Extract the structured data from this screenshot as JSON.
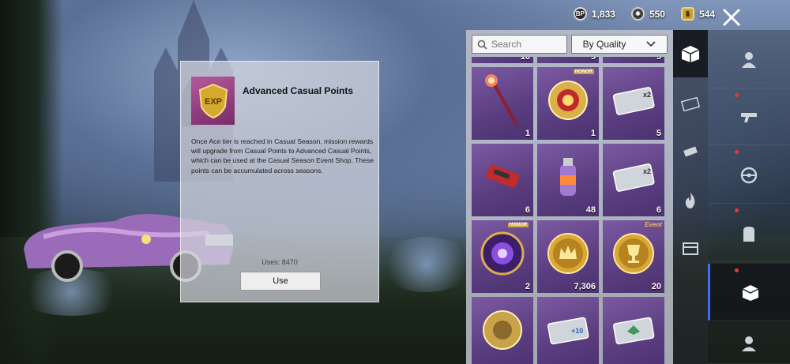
{
  "currencies": [
    {
      "icon": "bp-coin-icon",
      "glyph": "BP",
      "value": "1,833"
    },
    {
      "icon": "ag-coin-icon",
      "glyph": "",
      "value": "550"
    },
    {
      "icon": "uc-coin-icon",
      "glyph": "",
      "value": "544"
    }
  ],
  "popup": {
    "icon": "exp-badge-icon",
    "icon_text": "EXP",
    "title": "Advanced Casual Points",
    "description": "Once Ace tier is reached in Casual Season, mission rewards will upgrade from Casual Points to Advanced Casual Points, which can be used at the Casual Season Event Shop. These points can be accumulated across seasons.",
    "uses": "Uses: 8470",
    "use_label": "Use"
  },
  "inventory": {
    "search_placeholder": "Search",
    "sort_label": "By Quality",
    "items": [
      {
        "icon": "card-icon",
        "qty": "16",
        "partial": true
      },
      {
        "icon": "card-icon",
        "qty": "5",
        "partial": true
      },
      {
        "icon": "card-icon",
        "qty": "5",
        "partial": true
      },
      {
        "icon": "scepter-icon",
        "qty": "1"
      },
      {
        "icon": "honor-emblem-icon",
        "qty": "1",
        "honor": "HONOR"
      },
      {
        "icon": "double-ticket-icon",
        "qty": "5",
        "ticket_text": "x2"
      },
      {
        "icon": "red-device-icon",
        "qty": "6"
      },
      {
        "icon": "spray-can-icon",
        "qty": "48"
      },
      {
        "icon": "double-ticket-icon",
        "qty": "6",
        "ticket_text": "x2"
      },
      {
        "icon": "purple-emblem-icon",
        "qty": "2",
        "honor": "HONOR"
      },
      {
        "icon": "gold-crown-coin-icon",
        "qty": "7,306"
      },
      {
        "icon": "gold-trophy-coin-icon",
        "qty": "20",
        "event": "Event"
      },
      {
        "icon": "gold-emblem-icon",
        "qty": "",
        "partial": false
      },
      {
        "icon": "plus-ticket-icon",
        "qty": "",
        "ticket_text": "+10"
      },
      {
        "icon": "green-ticket-icon",
        "qty": ""
      }
    ]
  },
  "categories": [
    {
      "icon": "crate-icon"
    },
    {
      "icon": "sale-tag-icon"
    },
    {
      "icon": "ammo-icon"
    },
    {
      "icon": "flame-icon"
    },
    {
      "icon": "box-icon"
    }
  ],
  "subcategories": [
    {
      "icon": "character-icon"
    },
    {
      "icon": "gun-icon"
    },
    {
      "icon": "steering-wheel-icon"
    },
    {
      "icon": "backpack-icon"
    },
    {
      "icon": "box-white-icon"
    },
    {
      "icon": "soldier-icon"
    }
  ]
}
